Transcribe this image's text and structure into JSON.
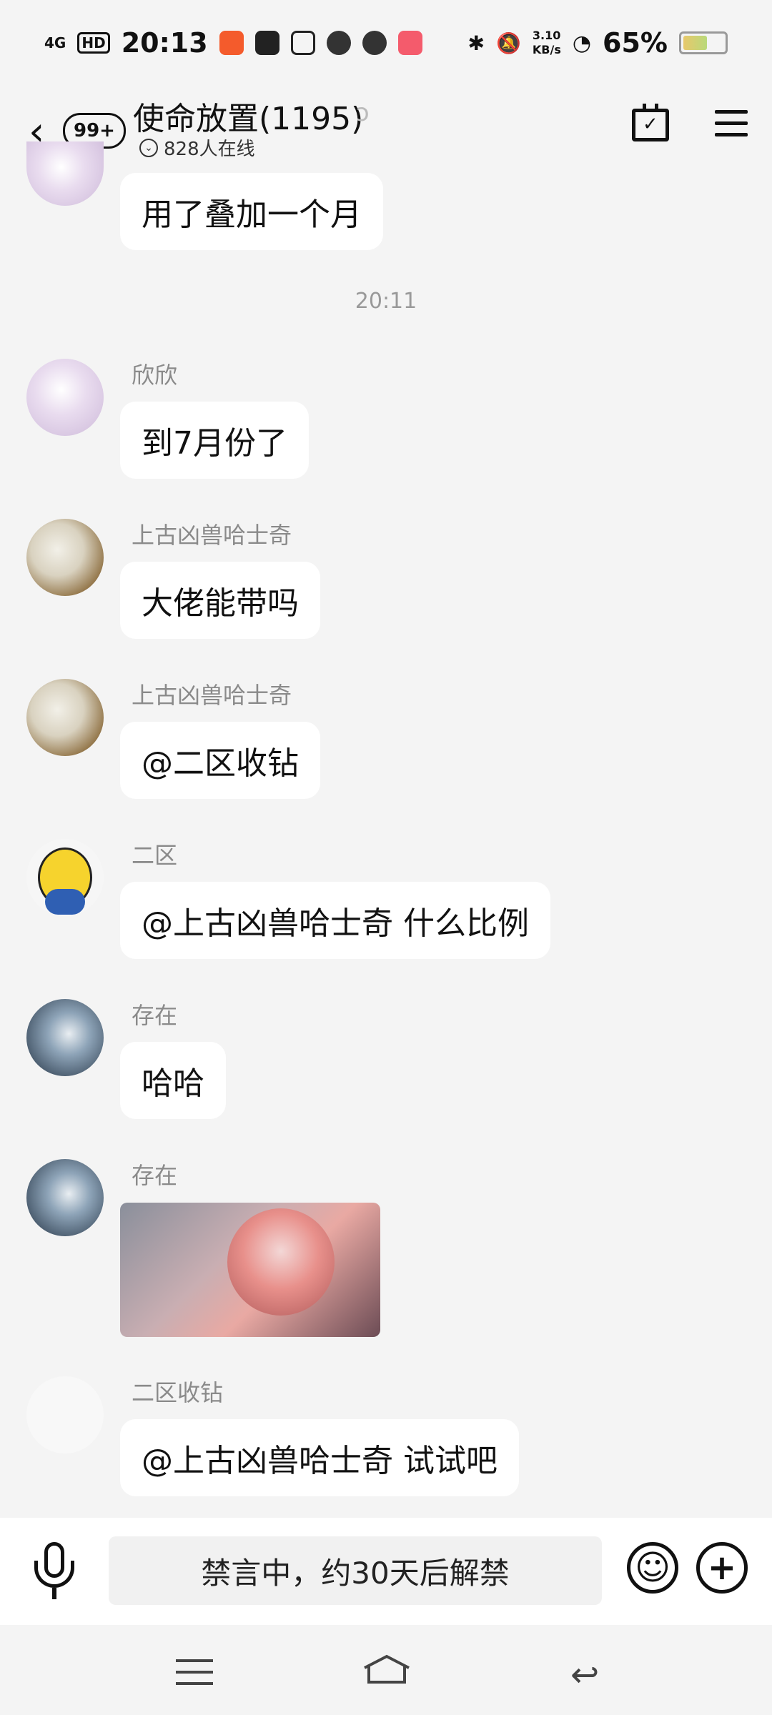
{
  "status": {
    "network": "4G",
    "hd": "HD",
    "time": "20:13",
    "speed": "3.10\nKB/s",
    "battery": "65%"
  },
  "header": {
    "badge": "99+",
    "title": "使命放置(1195)",
    "online": "828人在线"
  },
  "messages": [
    {
      "text": "用了叠加一个月"
    },
    {
      "timestamp": "20:11"
    },
    {
      "name": "欣欣",
      "text": "到7月份了"
    },
    {
      "name": "上古凶兽哈士奇",
      "text": "大佬能带吗"
    },
    {
      "name": "上古凶兽哈士奇",
      "text": "@二区收钻"
    },
    {
      "name": "二区",
      "text": "@上古凶兽哈士奇 什么比例"
    },
    {
      "name": "存在",
      "text": "哈哈"
    },
    {
      "name": "存在"
    },
    {
      "name": "二区收钻",
      "text": "@上古凶兽哈士奇 试试吧"
    }
  ],
  "input": {
    "muted_text": "禁言中，约30天后解禁"
  }
}
